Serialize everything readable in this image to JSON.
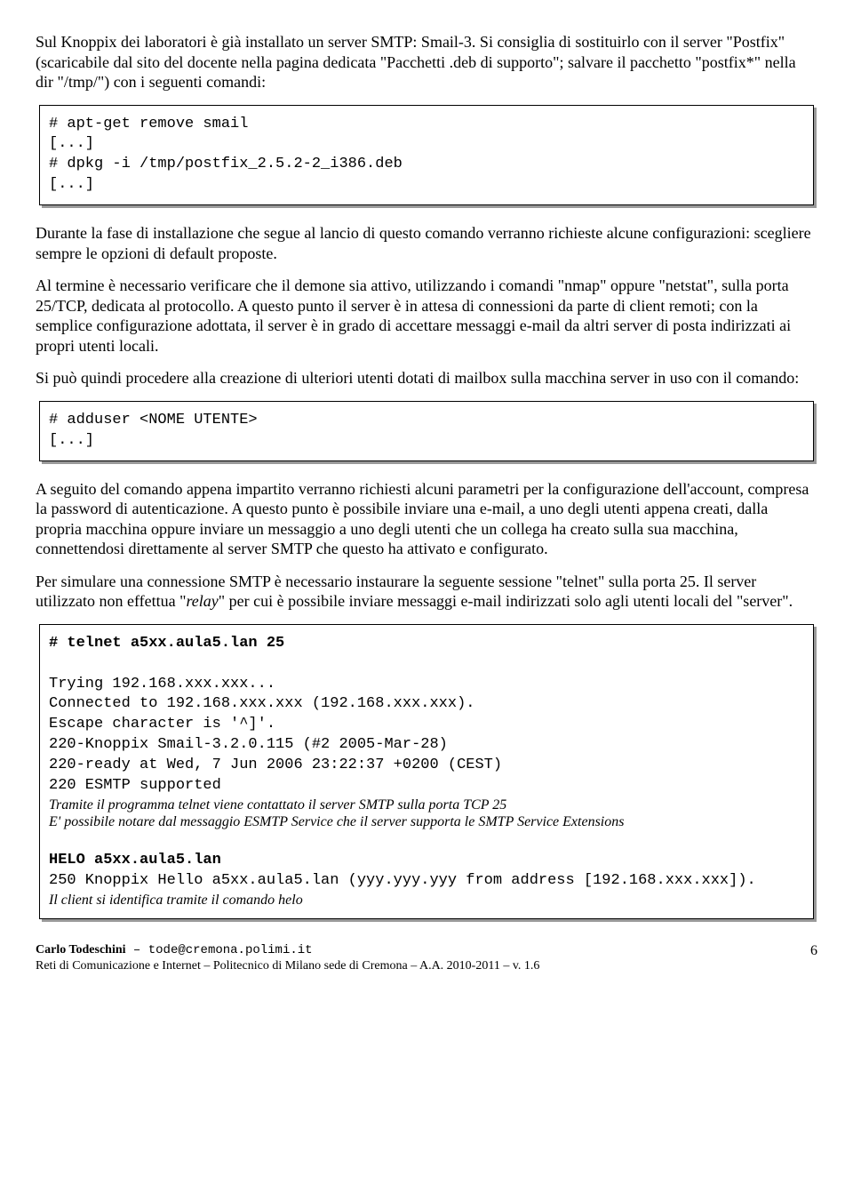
{
  "para1": "Sul Knoppix dei laboratori è già installato un server SMTP: Smail-3. Si consiglia di sostituirlo con il server \"Postfix\" (scaricabile dal sito del docente nella pagina dedicata \"Pacchetti .deb di supporto\"; salvare il pacchetto \"postfix*\" nella dir \"/tmp/\") con i seguenti comandi:",
  "code1": "# apt-get remove smail\n[...]\n# dpkg -i /tmp/postfix_2.5.2-2_i386.deb\n[...]",
  "para2": "Durante la fase di installazione che segue al lancio di questo comando verranno richieste alcune configurazioni: scegliere sempre le opzioni di default proposte.",
  "para3": "Al termine è necessario verificare che il demone sia attivo, utilizzando i comandi \"nmap\" oppure \"netstat\", sulla porta 25/TCP, dedicata al protocollo. A questo punto il server è in attesa di connessioni da parte di client remoti; con la semplice configurazione adottata, il server è in grado di accettare messaggi e-mail da altri server di posta indirizzati ai propri utenti locali.",
  "para4": "Si può quindi procedere alla creazione di ulteriori utenti dotati di mailbox sulla macchina server in uso con il comando:",
  "code2": "# adduser <NOME UTENTE>\n[...]",
  "para5": "A seguito del comando appena impartito verranno richiesti alcuni parametri per la configurazione dell'account, compresa la password di autenticazione. A questo punto è possibile inviare una e-mail, a uno degli utenti appena creati, dalla propria macchina oppure inviare un messaggio a uno degli utenti che un collega ha creato sulla sua macchina, connettendosi direttamente al server SMTP che questo ha attivato e configurato.",
  "para6_a": "Per simulare una connessione SMTP è necessario instaurare la seguente sessione \"telnet\" sulla porta 25. Il server utilizzato non effettua \"",
  "para6_relay": "relay",
  "para6_b": "\" per cui è possibile inviare messaggi e-mail indirizzati solo agli utenti locali del \"server\".",
  "code3": {
    "l1": "# telnet a5xx.aula5.lan 25",
    "blank1": "",
    "l2": "Trying 192.168.xxx.xxx...",
    "l3": "Connected to 192.168.xxx.xxx (192.168.xxx.xxx).",
    "l4": "Escape character is '^]'.",
    "l5": "220-Knoppix Smail-3.2.0.115 (#2 2005-Mar-28)",
    "l6": "220-ready at Wed, 7 Jun 2006 23:22:37 +0200 (CEST)",
    "l7": "220 ESMTP supported",
    "note1": "Tramite il programma telnet viene contattato il server SMTP sulla porta TCP 25",
    "note2": "E' possibile notare dal messaggio ESMTP Service che il server supporta le SMTP Service Extensions",
    "blank2": "",
    "l8": "HELO a5xx.aula5.lan",
    "l9": "250 Knoppix Hello a5xx.aula5.lan (yyy.yyy.yyy from address [192.168.xxx.xxx]).",
    "note3": "Il client si identifica tramite il comando helo"
  },
  "footer": {
    "author_name": "Carlo Todeschini",
    "author_email": " – tode@cremona.polimi.it",
    "line2": "Reti di Comunicazione e Internet – Politecnico di Milano sede di Cremona – A.A. 2010-2011 – v. 1.6",
    "pagenum": "6"
  }
}
